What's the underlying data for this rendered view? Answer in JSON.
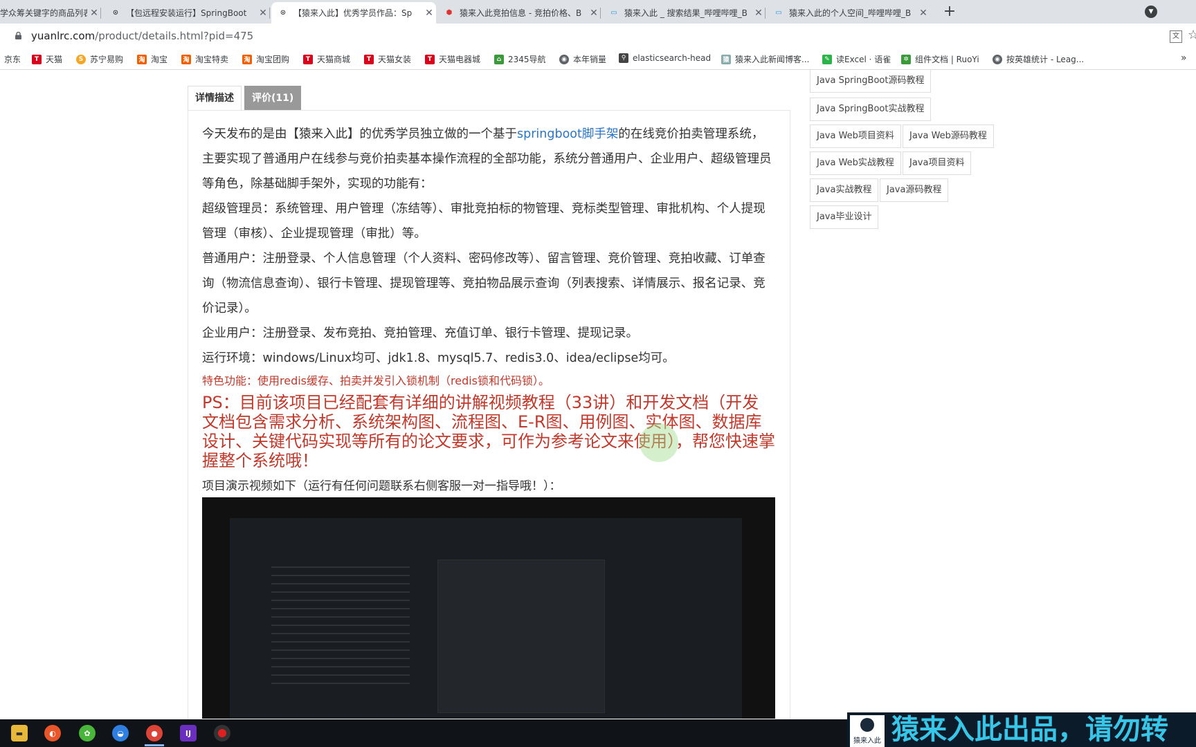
{
  "browser": {
    "tabs": [
      {
        "title": "学众筹关键字的商品列表",
        "active": false
      },
      {
        "title": "【包远程安装运行】SpringBoot",
        "active": false
      },
      {
        "title": "【猿来入此】优秀学员作品：Sp",
        "active": true
      },
      {
        "title": "猿来入此竞拍信息 - 竞拍价格、B",
        "active": false
      },
      {
        "title": "猿来入此 _ 搜索结果_哔哩哔哩_B",
        "active": false
      },
      {
        "title": "猿来入此的个人空间_哔哩哔哩_B",
        "active": false
      }
    ],
    "new_tab": "+",
    "url_host": "yuanlrc.com",
    "url_path": "/product/details.html?pid=475",
    "bookmarks": [
      "京东",
      "天猫",
      "苏宁易购",
      "淘宝",
      "淘宝特卖",
      "淘宝团购",
      "天猫商城",
      "天猫女装",
      "天猫电器城",
      "2345导航",
      "本年销量",
      "elasticsearch-head",
      "猿来入此新闻博客...",
      "读Excel · 语雀",
      "组件文档 | RuoYi",
      "按英雄统计 - Leag..."
    ],
    "bookmarks_more": "»"
  },
  "detail": {
    "tabs": [
      "详情描述",
      "评价(11)"
    ],
    "intro_before_link": "今天发布的是由【猿来入此】的优秀学员独立做的一个基于",
    "intro_link": "springboot脚手架",
    "intro_after_link": "的在线竞价拍卖管理系统，主要实现了普通用户在线参与竞价拍卖基本操作流程的全部功能，系统分普通用户、企业用户、超级管理员等角色，除基础脚手架外，实现的功能有：",
    "admin": "超级管理员：系统管理、用户管理（冻结等）、审批竞拍标的物管理、竞标类型管理、审批机构、个人提现管理（审核）、企业提现管理（审批）等。",
    "user": "普通用户：注册登录、个人信息管理（个人资料、密码修改等）、留言管理、竞价管理、竞拍收藏、订单查询（物流信息查询）、银行卡管理、提现管理等、竞拍物品展示查询（列表搜索、详情展示、报名记录、竞价记录）。",
    "enterprise": "企业用户：注册登录、发布竞拍、竞拍管理、充值订单、银行卡管理、提现记录。",
    "env": "运行环境：windows/Linux均可、jdk1.8、mysql5.7、redis3.0、idea/eclipse均可。",
    "feature": "特色功能：使用redis缓存、拍卖并发引入锁机制（redis锁和代码锁）。",
    "ps": "PS：目前该项目已经配套有详细的讲解视频教程（33讲）和开发文档（开发文档包含需求分析、系统架构图、流程图、E-R图、用例图、实体图、数据库设计、关键代码实现等所有的论文要求，可作为参考论文来使用），帮您快速掌握整个系统哦！",
    "demo": "项目演示视频如下（运行有任何问题联系右侧客服一对一指导哦！）："
  },
  "tags": [
    "Java SpringBoot源码教程",
    "Java SpringBoot实战教程",
    "Java Web项目资料",
    "Java Web源码教程",
    "Java Web实战教程",
    "Java项目资料",
    "Java实战教程",
    "Java源码教程",
    "Java毕业设计"
  ],
  "watermark": {
    "logo_text": "猿来入此",
    "text": "猿来入此出品，请勿转"
  },
  "colors": {
    "link": "#2a76c6",
    "red": "#c0392b",
    "tab_selected": "#999999",
    "watermark": "#38c6e8"
  }
}
